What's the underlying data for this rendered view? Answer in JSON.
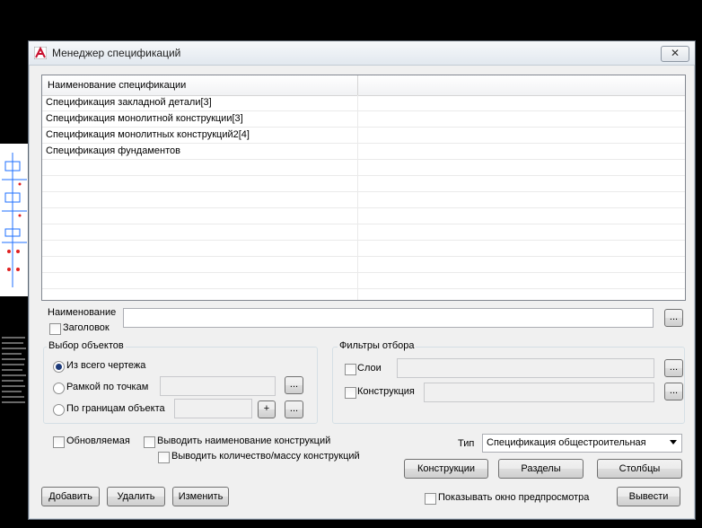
{
  "window": {
    "title": "Менеджер спецификаций",
    "close_glyph": "✕"
  },
  "list": {
    "column_header": "Наименование спецификации",
    "rows": [
      "Спецификация закладной детали[3]",
      "Спецификация монолитной конструкции[3]",
      "Спецификация монолитных конструкций2[4]",
      "Спецификация фундаментов"
    ]
  },
  "name": {
    "label": "Наименование",
    "value": "",
    "browse": "..."
  },
  "header_checkbox": {
    "label": "Заголовок",
    "checked": false
  },
  "selection": {
    "title": "Выбор объектов",
    "options": [
      {
        "label": "Из всего чертежа",
        "checked": true
      },
      {
        "label": "Рамкой по точкам",
        "checked": false
      },
      {
        "label": "По границам объекта",
        "checked": false
      }
    ],
    "browse": "...",
    "plus": "+"
  },
  "filters": {
    "title": "Фильтры отбора",
    "layers_label": "Слои",
    "construction_label": "Конструкция",
    "browse": "..."
  },
  "options": {
    "updatable": "Обновляемая",
    "show_names": "Выводить наименование конструкций",
    "show_quantity": "Выводить количество/массу конструкций"
  },
  "type": {
    "label": "Тип",
    "value": "Спецификация общестроительная"
  },
  "buttons": {
    "constructions": "Конструкции",
    "sections": "Разделы",
    "columns": "Столбцы",
    "add": "Добавить",
    "delete": "Удалить",
    "edit": "Изменить",
    "exit": "Вывести"
  },
  "preview": {
    "label": "Показывать окно предпросмотра",
    "checked": false
  },
  "colors": {
    "accent": "#1c3a7a",
    "cad_bg": "#000000",
    "cad_lines": "#1e90ff"
  }
}
